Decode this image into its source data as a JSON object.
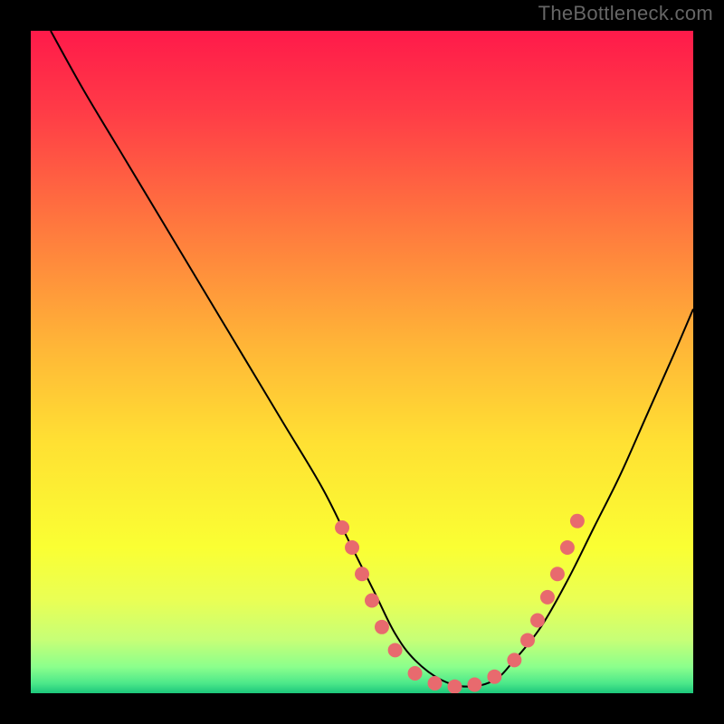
{
  "watermark": "TheBottleneck.com",
  "chart_data": {
    "type": "line",
    "title": "",
    "xlabel": "",
    "ylabel": "",
    "xlim": [
      0,
      100
    ],
    "ylim": [
      0,
      100
    ],
    "grid": false,
    "legend": false,
    "background_gradient_stops": [
      {
        "offset": 0.0,
        "color": "#FF1A4A"
      },
      {
        "offset": 0.12,
        "color": "#FF3B47"
      },
      {
        "offset": 0.3,
        "color": "#FF7A3E"
      },
      {
        "offset": 0.48,
        "color": "#FFB737"
      },
      {
        "offset": 0.62,
        "color": "#FFE033"
      },
      {
        "offset": 0.78,
        "color": "#FAFF33"
      },
      {
        "offset": 0.86,
        "color": "#E9FF55"
      },
      {
        "offset": 0.92,
        "color": "#C6FF77"
      },
      {
        "offset": 0.96,
        "color": "#8CFF8C"
      },
      {
        "offset": 0.985,
        "color": "#4CE88A"
      },
      {
        "offset": 1.0,
        "color": "#1CC67B"
      }
    ],
    "series": [
      {
        "name": "bottleneck-curve",
        "stroke": "#000000",
        "stroke_width": 2,
        "x": [
          3,
          8,
          14,
          20,
          26,
          32,
          38,
          44,
          48,
          52,
          55,
          58,
          62,
          66,
          70,
          73,
          77,
          81,
          85,
          89,
          93,
          97,
          100
        ],
        "y": [
          100,
          91,
          81,
          71,
          61,
          51,
          41,
          31,
          23,
          15,
          9,
          5,
          2,
          1,
          2,
          5,
          10,
          17,
          25,
          33,
          42,
          51,
          58
        ]
      }
    ],
    "marker_series": {
      "name": "optimal-region-points",
      "fill": "#E86A6E",
      "radius": 8,
      "points": [
        {
          "x": 47.0,
          "y": 25.0
        },
        {
          "x": 48.5,
          "y": 22.0
        },
        {
          "x": 50.0,
          "y": 18.0
        },
        {
          "x": 51.5,
          "y": 14.0
        },
        {
          "x": 53.0,
          "y": 10.0
        },
        {
          "x": 55.0,
          "y": 6.5
        },
        {
          "x": 58.0,
          "y": 3.0
        },
        {
          "x": 61.0,
          "y": 1.5
        },
        {
          "x": 64.0,
          "y": 1.0
        },
        {
          "x": 67.0,
          "y": 1.3
        },
        {
          "x": 70.0,
          "y": 2.5
        },
        {
          "x": 73.0,
          "y": 5.0
        },
        {
          "x": 75.0,
          "y": 8.0
        },
        {
          "x": 76.5,
          "y": 11.0
        },
        {
          "x": 78.0,
          "y": 14.5
        },
        {
          "x": 79.5,
          "y": 18.0
        },
        {
          "x": 81.0,
          "y": 22.0
        },
        {
          "x": 82.5,
          "y": 26.0
        }
      ]
    }
  }
}
